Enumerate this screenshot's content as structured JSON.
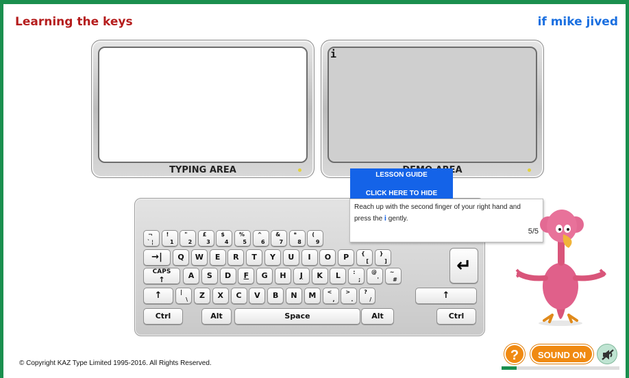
{
  "header": {
    "lesson_title": "Learning the keys",
    "lesson_text": "if mike jived"
  },
  "typing_area": {
    "label": "TYPING AREA"
  },
  "demo_area": {
    "label": "DEMO AREA",
    "current_char": "i"
  },
  "lesson_guide": {
    "title": "LESSON GUIDE",
    "hide_label": "CLICK HERE TO HIDE",
    "instruction_before": "Reach up with the second finger of your right hand and press the ",
    "instruction_key": "i",
    "instruction_after": " gently.",
    "step": "5/5"
  },
  "keyboard": {
    "row_numbers": [
      {
        "top": "¬",
        "bottom": "`",
        "extra": "¦"
      },
      {
        "top": "!",
        "bottom": "1"
      },
      {
        "top": "\"",
        "bottom": "2"
      },
      {
        "top": "£",
        "bottom": "3"
      },
      {
        "top": "$",
        "bottom": "4"
      },
      {
        "top": "%",
        "bottom": "5"
      },
      {
        "top": "^",
        "bottom": "6"
      },
      {
        "top": "&",
        "bottom": "7"
      },
      {
        "top": "*",
        "bottom": "8"
      },
      {
        "top": "(",
        "bottom": "9"
      }
    ],
    "tab_label": "→|",
    "row_top": [
      "Q",
      "W",
      "E",
      "R",
      "T",
      "Y",
      "U",
      "I",
      "O",
      "P"
    ],
    "row_top_extra": [
      {
        "top": "{",
        "bottom": "["
      },
      {
        "top": "}",
        "bottom": "]"
      }
    ],
    "caps_label": "CAPS",
    "caps_arrow": "↑",
    "row_home": [
      "A",
      "S",
      "D",
      "F",
      "G",
      "H",
      "J",
      "K",
      "L"
    ],
    "row_home_extra": [
      {
        "top": ":",
        "bottom": ";"
      },
      {
        "top": "@",
        "bottom": "'"
      },
      {
        "top": "~",
        "bottom": "#"
      }
    ],
    "shift_label": "↑",
    "row_bottom_extra_left": {
      "top": "|",
      "bottom": "\\"
    },
    "row_bottom": [
      "Z",
      "X",
      "C",
      "V",
      "B",
      "N",
      "M"
    ],
    "row_bottom_extra": [
      {
        "top": "<",
        "bottom": ","
      },
      {
        "top": ">",
        "bottom": "."
      },
      {
        "top": "?",
        "bottom": "/"
      }
    ],
    "ctrl_label": "Ctrl",
    "alt_label": "Alt",
    "space_label": "Space",
    "enter_label": "↵"
  },
  "footer": {
    "copyright": "© Copyright KAZ Type Limited 1995-2016. All Rights Reserved.",
    "help_label": "?",
    "sound_label": "SOUND ON",
    "progress": 0.13
  },
  "colors": {
    "accent_green": "#1a8f4e",
    "title_red": "#b51d1d",
    "lesson_blue": "#1a6fe0",
    "guide_blue": "#1463e8",
    "button_orange": "#f08a12"
  },
  "icons": {
    "mute": "speaker-muted-icon",
    "help": "question-icon"
  }
}
